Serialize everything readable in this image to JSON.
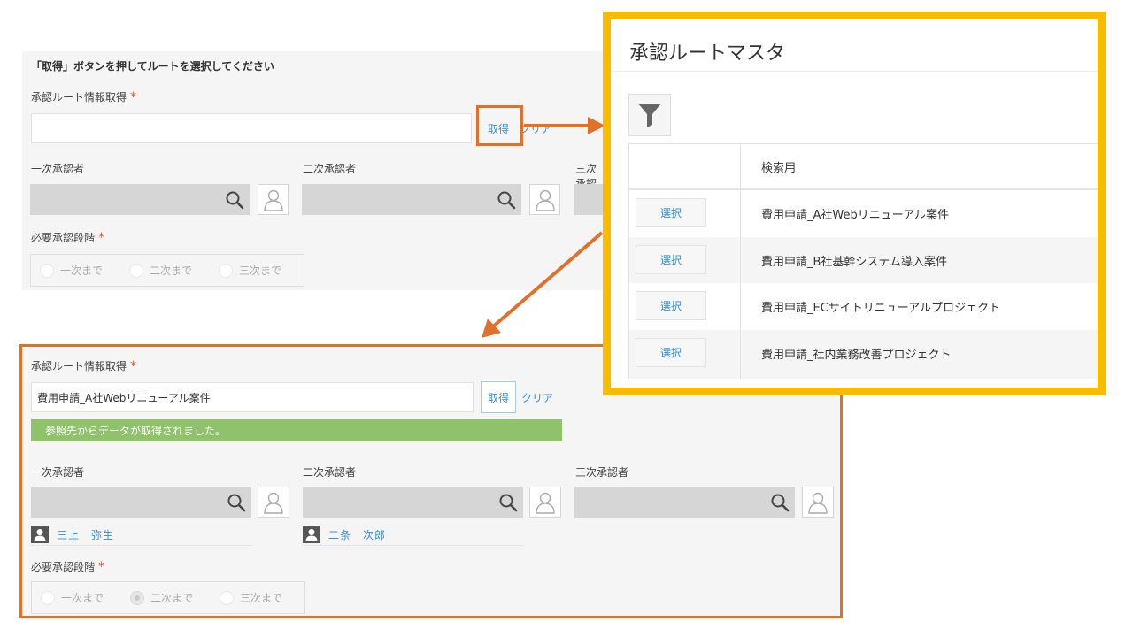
{
  "top_form": {
    "instruction": "「取得」ボタンを押してルートを選択してください",
    "route_label": "承認ルート情報取得",
    "required_mark": "*",
    "route_value": "",
    "get_button": "取得",
    "clear_link": "クリア",
    "first_approver_label": "一次承認者",
    "second_approver_label": "二次承認者",
    "third_approver_label": "三次承認者",
    "stage_label": "必要承認段階",
    "stage_options": [
      "一次まで",
      "二次まで",
      "三次まで"
    ]
  },
  "bottom_form": {
    "route_label": "承認ルート情報取得",
    "required_mark": "*",
    "route_value": "費用申請_A社Webリニューアル案件",
    "get_button": "取得",
    "clear_link": "クリア",
    "success_message": "参照先からデータが取得されました。",
    "first_approver_label": "一次承認者",
    "second_approver_label": "二次承認者",
    "third_approver_label": "三次承認者",
    "first_approver_name": "三上　弥生",
    "second_approver_name": "二条　次郎",
    "stage_label": "必要承認段階",
    "stage_options": [
      "一次まで",
      "二次まで",
      "三次まで"
    ],
    "selected_stage": "二次まで"
  },
  "modal": {
    "title": "承認ルートマスタ",
    "column_header": "検索用",
    "select_label": "選択",
    "rows": [
      "費用申請_A社Webリニューアル案件",
      "費用申請_B社基幹システム導入案件",
      "費用申請_ECサイトリニューアルプロジェクト",
      "費用申請_社内業務改善プロジェクト"
    ]
  },
  "icons": {
    "search": "search-icon",
    "user": "user-icon",
    "filter": "filter-icon",
    "avatar": "avatar-icon"
  },
  "colors": {
    "highlight_orange": "#e0712b",
    "modal_border_yellow": "#f7bc00",
    "link_blue": "#3d8fd1",
    "success_green": "#8fc26a",
    "required_red": "#e05a3a"
  }
}
